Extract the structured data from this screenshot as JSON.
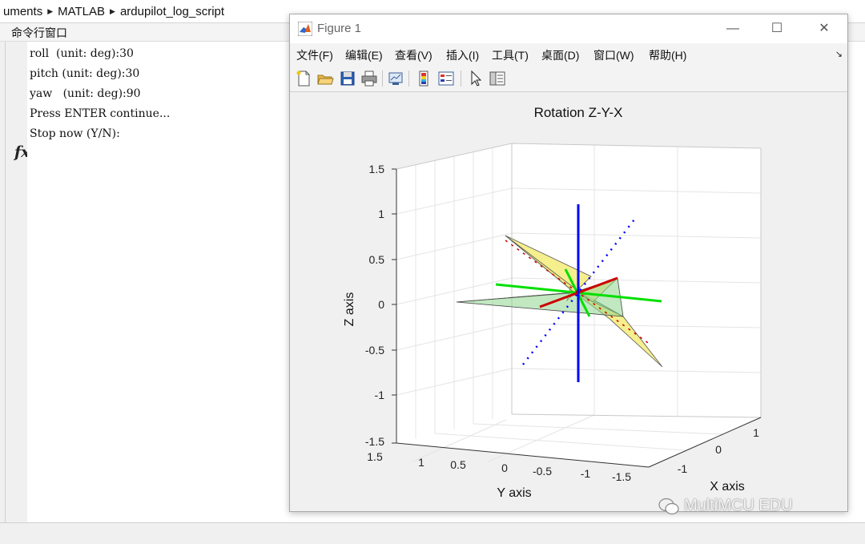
{
  "breadcrumb": {
    "segments": [
      "uments",
      "MATLAB",
      "ardupilot_log_script"
    ]
  },
  "command_window": {
    "title": "命令行窗口",
    "lines": [
      "roll  (unit: deg):30",
      "pitch (unit: deg):30",
      "yaw   (unit: deg):90",
      "Press ENTER continue...",
      "Stop now (Y/N):"
    ],
    "prompt_icon": "fx-icon"
  },
  "figure": {
    "window_title": "Figure 1",
    "menu": [
      "文件(F)",
      "编辑(E)",
      "查看(V)",
      "插入(I)",
      "工具(T)",
      "桌面(D)",
      "窗口(W)",
      "帮助(H)"
    ],
    "toolbar_icons": [
      "new-figure-icon",
      "open-file-icon",
      "save-icon",
      "print-icon",
      "link-plot-icon",
      "colorbar-icon",
      "legend-icon",
      "pointer-icon",
      "property-inspector-icon"
    ],
    "plot": {
      "title": "Rotation Z-Y-X",
      "xlabel": "X axis",
      "ylabel": "Y axis",
      "zlabel": "Z axis",
      "z_ticks": [
        "1.5",
        "1",
        "0.5",
        "0",
        "-0.5",
        "-1",
        "-1.5"
      ],
      "y_ticks": [
        "1.5",
        "1",
        "0.5",
        "0",
        "-0.5",
        "-1",
        "-1.5"
      ],
      "x_ticks": [
        "1",
        "0",
        "-1"
      ]
    }
  },
  "watermark": "MultiMCU EDU",
  "chart_data": {
    "type": "3d-line",
    "title": "Rotation Z-Y-X",
    "xlabel": "X axis",
    "ylabel": "Y axis",
    "zlabel": "Z axis",
    "xlim": [
      -1.5,
      1.5
    ],
    "ylim": [
      -1.5,
      1.5
    ],
    "zlim": [
      -1.5,
      1.5
    ],
    "grid": true,
    "rotation_deg": {
      "roll": 30,
      "pitch": 30,
      "yaw": 90
    },
    "colors": {
      "x_axis": "#0000ff",
      "y_axis": "#00e000",
      "z_axis": "#0000ff",
      "body": "#cc0000",
      "wing_green": "#66cc66",
      "wing_yellow": "#f0e060"
    }
  }
}
